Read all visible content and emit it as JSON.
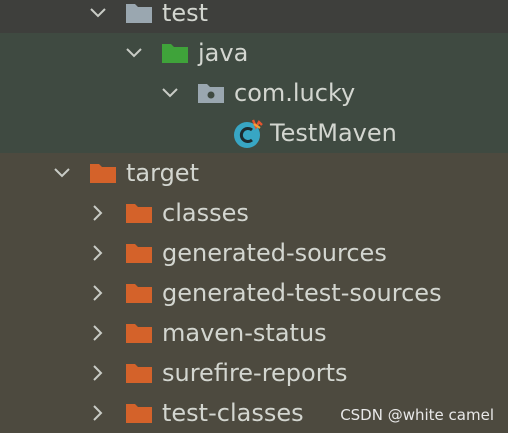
{
  "tree": {
    "items": [
      {
        "label": "test",
        "icon": "folder-gray-icon",
        "expanded": true
      },
      {
        "label": "java",
        "icon": "folder-green-icon",
        "expanded": true
      },
      {
        "label": "com.lucky",
        "icon": "package-icon",
        "expanded": true
      },
      {
        "label": "TestMaven",
        "icon": "java-class-icon"
      },
      {
        "label": "target",
        "icon": "folder-orange-icon",
        "expanded": true
      },
      {
        "label": "classes",
        "icon": "folder-orange-icon",
        "expanded": false
      },
      {
        "label": "generated-sources",
        "icon": "folder-orange-icon",
        "expanded": false
      },
      {
        "label": "generated-test-sources",
        "icon": "folder-orange-icon",
        "expanded": false
      },
      {
        "label": "maven-status",
        "icon": "folder-orange-icon",
        "expanded": false
      },
      {
        "label": "surefire-reports",
        "icon": "folder-orange-icon",
        "expanded": false
      },
      {
        "label": "test-classes",
        "icon": "folder-orange-icon",
        "expanded": false
      }
    ]
  },
  "watermark": "CSDN @white camel",
  "colors": {
    "background": "#4d4a3f",
    "selected_band": "#3f4a41",
    "text": "#d3d6d0",
    "folder_orange": "#d4622a",
    "folder_green": "#3fa33a",
    "folder_gray": "#9aa7b0",
    "class_icon": "#38a6c4"
  }
}
